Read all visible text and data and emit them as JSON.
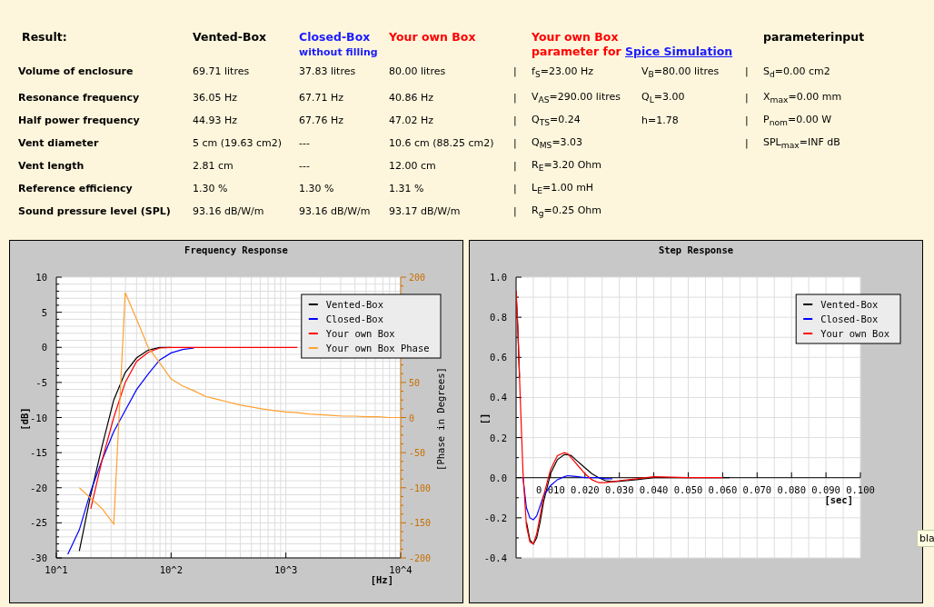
{
  "results": {
    "label": "Result:",
    "columns": [
      {
        "title": "Vented-Box",
        "color": "#000000"
      },
      {
        "title": "Closed-Box",
        "subtitle": "without filling",
        "color": "#1a1aff"
      },
      {
        "title": "Your own Box",
        "color": "#ff0000"
      }
    ],
    "spice": {
      "title": "Your own Box",
      "subtitle": "parameter for",
      "link": "Spice Simulation",
      "color": "#ff0000"
    },
    "parameters": {
      "title": "parameterinput"
    },
    "rows": [
      {
        "label": "Volume of enclosure",
        "vented": "69.71 litres",
        "closed": "37.83 litres",
        "own": "80.00 litres",
        "sep_1": "|",
        "spice_1": "f$_{S}$=23.00 Hz",
        "spice_2": "V$_{B}$=80.00 litres",
        "sep_2": "|",
        "param": "S$_{d}$=0.00 cm2"
      },
      {
        "label": "Resonance frequency",
        "vented": "36.05 Hz",
        "closed": "67.71 Hz",
        "own": "40.86 Hz",
        "sep_1": "|",
        "spice_1": "V$_{AS}$=290.00 litres",
        "spice_2": "Q$_{L}$=3.00",
        "sep_2": "|",
        "param": "X$_{max}$=0.00 mm"
      },
      {
        "label": "Half power frequency",
        "vented": "44.93 Hz",
        "closed": "67.76 Hz",
        "own": "47.02 Hz",
        "sep_1": "|",
        "spice_1": "Q$_{TS}$=0.24",
        "spice_2": "h=1.78",
        "sep_2": "|",
        "param": "P$_{nom}$=0.00 W"
      },
      {
        "label": "Vent diameter",
        "vented": "5 cm (19.63 cm2)",
        "closed": "---",
        "own": "10.6 cm (88.25 cm2)",
        "sep_1": "|",
        "spice_1": "Q$_{MS}$=3.03",
        "sep_2": "|",
        "param": "SPL$_{max}$=INF dB"
      },
      {
        "label": "Vent length",
        "vented": "2.81 cm",
        "closed": "---",
        "own": "12.00 cm",
        "sep_1": "|",
        "spice_1": "R$_{E}$=3.20 Ohm"
      },
      {
        "label": "Reference efficiency",
        "vented": "1.30 %",
        "closed": "1.30 %",
        "own": "1.31 %",
        "sep_1": "|",
        "spice_1": "L$_{E}$=1.00 mH"
      },
      {
        "label": "Sound pressure level (SPL)",
        "vented": "93.16 dB/W/m",
        "closed": "93.16 dB/W/m",
        "own": "93.17 dB/W/m",
        "sep_1": "|",
        "spice_1": "R$_{g}$=0.25 Ohm"
      }
    ]
  },
  "charts": [
    {
      "chart_data": {
        "type": "line",
        "title": "Frequency Response",
        "xlabel": "[Hz]",
        "ylabel": "[dB]",
        "y2label": "[Phase in Degrees]",
        "grid": true,
        "legend": "upper right",
        "categories": [
          "10^1",
          null,
          null,
          null,
          null,
          null,
          null,
          null,
          null,
          null,
          "10^2",
          null,
          null,
          null,
          null,
          null,
          null,
          null,
          null,
          null,
          "10^3",
          null,
          null,
          null,
          null,
          null,
          null,
          null,
          null,
          null,
          "10^4"
        ],
        "series": [
          {
            "name": "Vented-Box",
            "color": "#000000",
            "values": [
              null,
              null,
              -29,
              -21,
              -14,
              -7.5,
              -3.6,
              -1.5,
              -0.4,
              0,
              0,
              null,
              null,
              null,
              null,
              null,
              null,
              null,
              null,
              null,
              null,
              null,
              null,
              null,
              null,
              null,
              null,
              null,
              null,
              null,
              null
            ]
          },
          {
            "name": "Closed-Box",
            "color": "#0000ff",
            "values": [
              null,
              -29.5,
              -26,
              -20.5,
              -16,
              -12,
              -9,
              -6,
              -3.8,
              -1.8,
              -0.8,
              -0.3,
              -0.1,
              null,
              null,
              null,
              null,
              null,
              null,
              null,
              null,
              null,
              null,
              null,
              null,
              null,
              null,
              null,
              null,
              null,
              null
            ]
          },
          {
            "name": "Your own Box",
            "color": "#ff0000",
            "values": [
              null,
              null,
              null,
              -23,
              -16,
              -10,
              -5,
              -2,
              -0.7,
              -0.1,
              0,
              0,
              0,
              0,
              0,
              0,
              0,
              0,
              0,
              0,
              0,
              0,
              null,
              null,
              null,
              null,
              null,
              null,
              null,
              null,
              null
            ]
          },
          {
            "name": "Your own Box Phase",
            "color": "#ffa030",
            "axis": "y2",
            "values": [
              null,
              null,
              -100,
              -115,
              -130,
              -152,
              178,
              140,
              100,
              78,
              55,
              45,
              38,
              30,
              26,
              22,
              18,
              15,
              12,
              10,
              8,
              7,
              5,
              4,
              3,
              2,
              2,
              1,
              1,
              0,
              0
            ]
          }
        ],
        "ylim": [
          -30,
          10
        ],
        "y2lim": [
          -200,
          200
        ],
        "yticks": [
          -30,
          -25,
          -20,
          -15,
          -10,
          -5,
          0,
          5,
          10
        ],
        "y2ticks": [
          -200,
          -150,
          -100,
          -50,
          0,
          50,
          200
        ]
      }
    },
    {
      "chart_data": {
        "type": "line",
        "title": "Step Response",
        "xlabel": "[sec]",
        "ylabel": "[]",
        "grid": true,
        "legend": "upper right",
        "x": [
          0,
          0.0005,
          0.001,
          0.002,
          0.003,
          0.004,
          0.005,
          0.006,
          0.007,
          0.008,
          0.01,
          0.012,
          0.014,
          0.015,
          0.016,
          0.018,
          0.02,
          0.022,
          0.024,
          0.026,
          0.028,
          0.03,
          0.035,
          0.04,
          0.05,
          0.06,
          0.062
        ],
        "series": [
          {
            "name": "Vented-Box",
            "color": "#000000",
            "values": [
              0.93,
              0.75,
              0.5,
              null,
              -0.22,
              -0.31,
              -0.33,
              -0.3,
              -0.22,
              -0.12,
              0.02,
              0.09,
              0.115,
              0.115,
              0.11,
              0.08,
              0.05,
              0.02,
              0.0,
              -0.015,
              -0.02,
              -0.018,
              -0.01,
              0,
              0,
              0,
              0
            ]
          },
          {
            "name": "Closed-Box",
            "color": "#0000ff",
            "values": [
              null,
              null,
              null,
              0.0,
              -0.15,
              -0.2,
              -0.21,
              -0.19,
              -0.14,
              -0.09,
              -0.04,
              -0.01,
              0.005,
              0.01,
              0.008,
              0.005,
              0.0,
              0,
              0,
              -0.005,
              -0.005,
              null,
              null,
              null,
              null,
              null,
              null
            ]
          },
          {
            "name": "Your own Box",
            "color": "#ff0000",
            "values": [
              0.93,
              0.75,
              0.5,
              0.03,
              -0.24,
              -0.32,
              -0.33,
              -0.28,
              -0.19,
              -0.09,
              0.04,
              0.11,
              0.125,
              0.12,
              0.1,
              0.06,
              0.02,
              -0.01,
              -0.025,
              -0.025,
              -0.02,
              -0.015,
              -0.005,
              0.005,
              0,
              0,
              null
            ]
          }
        ],
        "xlim": [
          0,
          0.1
        ],
        "ylim": [
          -0.4,
          1.0
        ],
        "xticks": [
          {
            "value": 0.01,
            "label": "0.010"
          },
          {
            "value": 0.02,
            "label": "0.020"
          },
          {
            "value": 0.03,
            "label": "0.030"
          },
          {
            "value": 0.04,
            "label": "0.040"
          },
          {
            "value": 0.05,
            "label": "0.050"
          },
          {
            "value": 0.06,
            "label": "0.060"
          },
          {
            "value": 0.07,
            "label": "0.070"
          },
          {
            "value": 0.08,
            "label": "0.080"
          },
          {
            "value": 0.09,
            "label": "0.090"
          },
          {
            "value": 0.1,
            "label": "0.100"
          }
        ],
        "yticks": [
          {
            "value": -0.4,
            "label": "-0.4"
          },
          {
            "value": -0.2,
            "label": "-0.2"
          },
          {
            "value": 0,
            "label": "0.0"
          },
          {
            "value": 0.2,
            "label": "0.2"
          },
          {
            "value": 0.4,
            "label": "0.4"
          },
          {
            "value": 0.6,
            "label": "0.6"
          },
          {
            "value": 0.8,
            "label": "0.8"
          },
          {
            "value": 1,
            "label": "1.0"
          }
        ]
      }
    }
  ],
  "tooltip": {
    "text": "bla"
  }
}
